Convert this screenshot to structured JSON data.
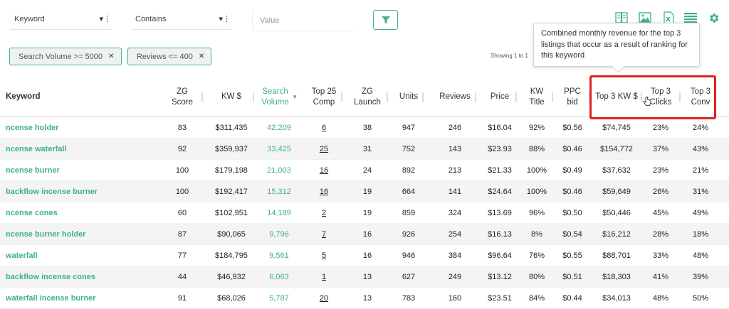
{
  "filters": {
    "field_select": "Keyword",
    "operator_select": "Contains",
    "value_placeholder": "Value"
  },
  "active_filters": [
    {
      "label": "Search Volume >= 5000"
    },
    {
      "label": "Reviews <= 400"
    }
  ],
  "showing_text": "Showing 1 to 1",
  "tooltip_text": "Combined monthly revenue for the top 3 listings that occur as a result of ranking for this keyword",
  "toolbar_icons": [
    "book-icon",
    "image-icon",
    "excel-export-icon",
    "list-settings-icon",
    "gear-icon"
  ],
  "colors": {
    "accent": "#3fae96",
    "highlight": "#e02020",
    "row_alt": "#f4f4f4"
  },
  "columns": [
    {
      "key": "keyword",
      "label": "Keyword"
    },
    {
      "key": "zg_score",
      "label": "ZG Score"
    },
    {
      "key": "kw_dollar",
      "label": "KW $"
    },
    {
      "key": "search_volume",
      "label": "Search Volume"
    },
    {
      "key": "top25_comp",
      "label": "Top 25 Comp"
    },
    {
      "key": "zg_launch",
      "label": "ZG Launch"
    },
    {
      "key": "units",
      "label": "Units"
    },
    {
      "key": "reviews",
      "label": "Reviews"
    },
    {
      "key": "price",
      "label": "Price"
    },
    {
      "key": "kw_title",
      "label": "KW Title"
    },
    {
      "key": "ppc_bid",
      "label": "PPC bid"
    },
    {
      "key": "top3_kw",
      "label": "Top 3 KW $"
    },
    {
      "key": "top3_clicks",
      "label": "Top 3 Clicks"
    },
    {
      "key": "top3_conv",
      "label": "Top 3 Conv"
    }
  ],
  "rows": [
    [
      "ncense holder",
      "83",
      "$311,435",
      "42,209",
      "6",
      "38",
      "947",
      "246",
      "$16.04",
      "92%",
      "$0.56",
      "$74,745",
      "23%",
      "24%"
    ],
    [
      "ncense waterfall",
      "92",
      "$359,937",
      "33,425",
      "25",
      "31",
      "752",
      "143",
      "$23.93",
      "88%",
      "$0.46",
      "$154,772",
      "37%",
      "43%"
    ],
    [
      "ncense burner",
      "100",
      "$179,198",
      "21,003",
      "16",
      "24",
      "892",
      "213",
      "$21.33",
      "100%",
      "$0.49",
      "$37,632",
      "23%",
      "21%"
    ],
    [
      "backflow incense burner",
      "100",
      "$192,417",
      "15,312",
      "16",
      "19",
      "664",
      "141",
      "$24.64",
      "100%",
      "$0.46",
      "$59,649",
      "26%",
      "31%"
    ],
    [
      "ncense cones",
      "60",
      "$102,951",
      "14,189",
      "2",
      "19",
      "859",
      "324",
      "$13.69",
      "96%",
      "$0.50",
      "$50,446",
      "45%",
      "49%"
    ],
    [
      "ncense burner holder",
      "87",
      "$90,065",
      "9,796",
      "7",
      "16",
      "926",
      "254",
      "$16.13",
      "8%",
      "$0.54",
      "$16,212",
      "28%",
      "18%"
    ],
    [
      "waterfall",
      "77",
      "$184,795",
      "9,561",
      "5",
      "16",
      "946",
      "384",
      "$96.64",
      "76%",
      "$0.55",
      "$88,701",
      "33%",
      "48%"
    ],
    [
      "backflow incense cones",
      "44",
      "$46,932",
      "6,063",
      "1",
      "13",
      "627",
      "249",
      "$13.12",
      "80%",
      "$0.51",
      "$18,303",
      "41%",
      "39%"
    ],
    [
      "waterfall incense burner",
      "91",
      "$68,026",
      "5,787",
      "20",
      "13",
      "783",
      "160",
      "$23.51",
      "84%",
      "$0.44",
      "$34,013",
      "48%",
      "50%"
    ]
  ]
}
